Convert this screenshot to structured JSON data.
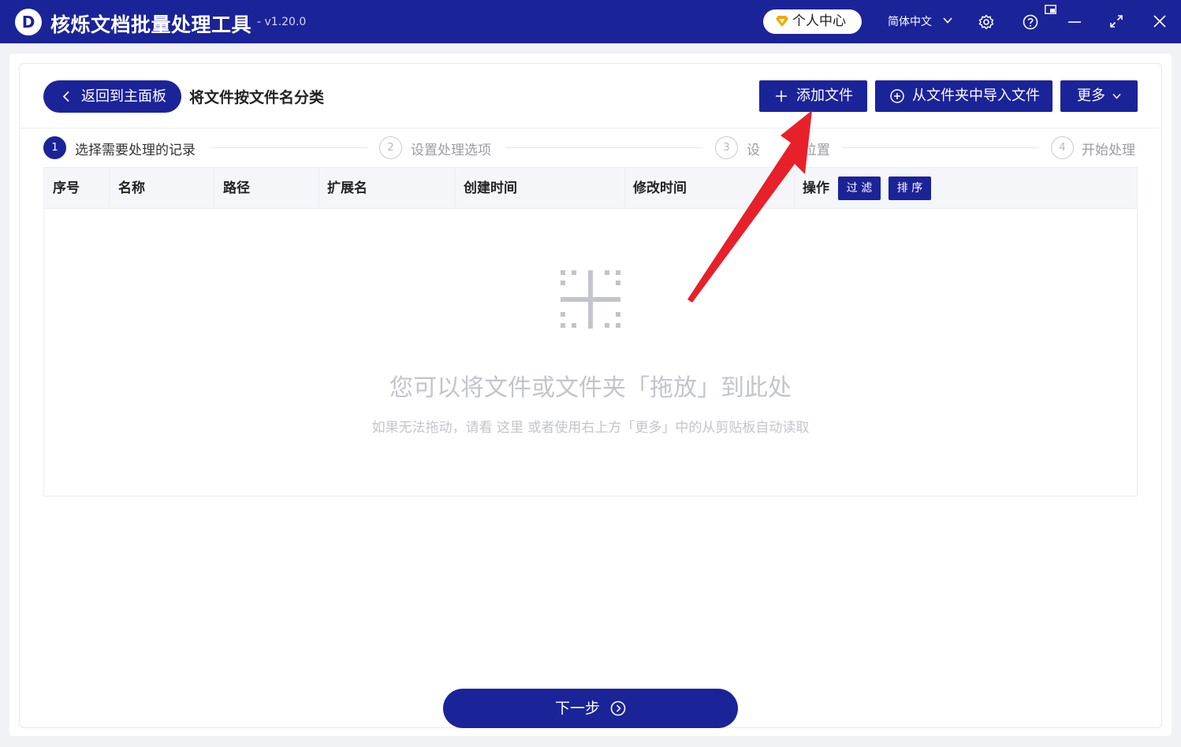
{
  "app": {
    "logo_letter": "D",
    "title": "核烁文档批量处理工具",
    "version": "- v1.20.0",
    "user_center": "个人中心",
    "language": "简体中文"
  },
  "toolbar": {
    "back_label": "返回到主面板",
    "page_title": "将文件按文件名分类",
    "add_file_label": "添加文件",
    "import_folder_label": "从文件夹中导入文件",
    "more_label": "更多"
  },
  "steps": [
    {
      "number": "1",
      "label": "选择需要处理的记录"
    },
    {
      "number": "2",
      "label": "设置处理选项"
    },
    {
      "number": "3",
      "label_left": "设",
      "label_right": "位置"
    },
    {
      "number": "4",
      "label": "开始处理"
    }
  ],
  "table": {
    "columns": [
      "序号",
      "名称",
      "路径",
      "扩展名",
      "创建时间",
      "修改时间",
      "操作"
    ],
    "filter_label": "过 滤",
    "sort_label": "排 序"
  },
  "empty_state": {
    "main_text": "您可以将文件或文件夹「拖放」到此处",
    "sub_text": "如果无法拖动，请看  这里   或者使用右上方「更多」中的从剪贴板自动读取"
  },
  "footer": {
    "next_label": "下一步"
  },
  "colors": {
    "brand": "#1b2399",
    "annotation_arrow": "#e8202a"
  }
}
